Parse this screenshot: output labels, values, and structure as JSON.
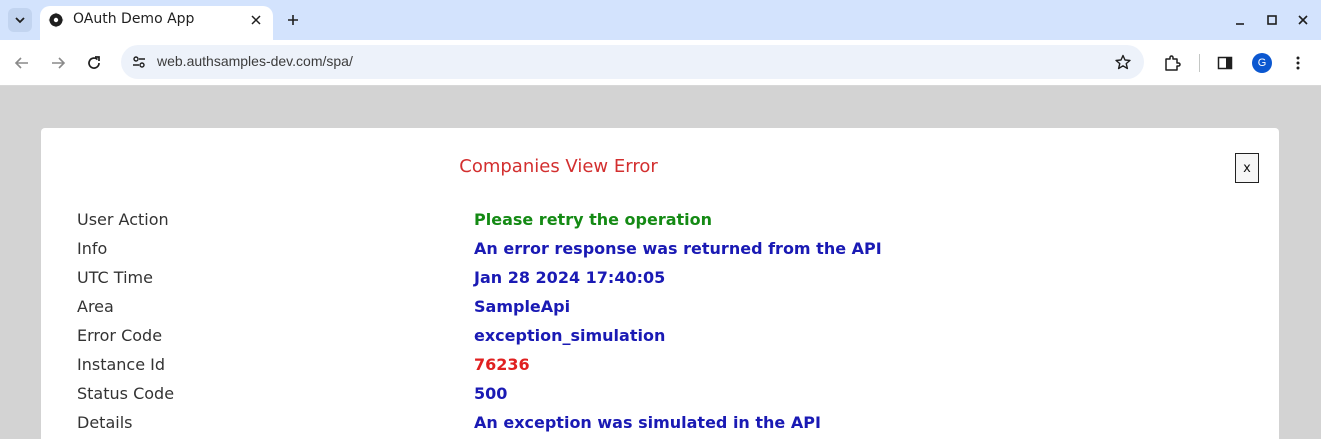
{
  "browser": {
    "tab_title": "OAuth Demo App",
    "url": "web.authsamples-dev.com/spa/",
    "avatar_letter": "G"
  },
  "panel": {
    "title": "Companies View Error",
    "close_label": "x",
    "rows": [
      {
        "label": "User Action",
        "value": "Please retry the operation",
        "color": "#148a14"
      },
      {
        "label": "Info",
        "value": "An error response was returned from the API",
        "color": "#1a1ab4"
      },
      {
        "label": "UTC Time",
        "value": "Jan 28 2024 17:40:05",
        "color": "#1a1ab4"
      },
      {
        "label": "Area",
        "value": "SampleApi",
        "color": "#1a1ab4"
      },
      {
        "label": "Error Code",
        "value": "exception_simulation",
        "color": "#1a1ab4"
      },
      {
        "label": "Instance Id",
        "value": "76236",
        "color": "#e02020"
      },
      {
        "label": "Status Code",
        "value": "500",
        "color": "#1a1ab4"
      },
      {
        "label": "Details",
        "value": "An exception was simulated in the API",
        "color": "#1a1ab4"
      }
    ]
  },
  "colors": {
    "tabstrip_bg": "#d3e3fd",
    "page_bg": "#d3d3d3",
    "title_red": "#d32f2f"
  }
}
